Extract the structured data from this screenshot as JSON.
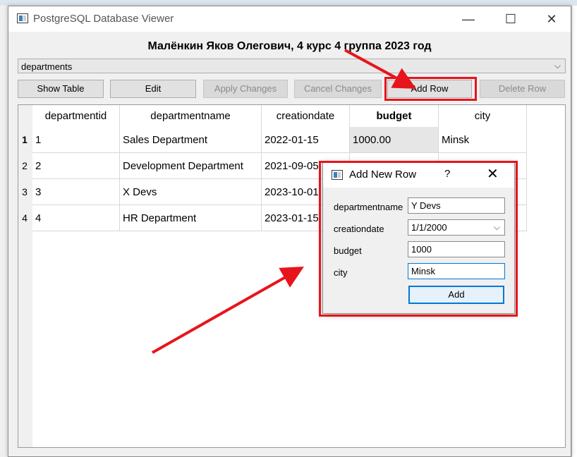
{
  "window": {
    "title": "PostgreSQL Database Viewer",
    "minimize": "—",
    "maximize": "☐",
    "close": "✕"
  },
  "header": {
    "title": "Малёнкин Яков Олегович, 4 курс 4 группа 2023 год"
  },
  "table_select": {
    "value": "departments",
    "arrow": "⌵"
  },
  "toolbar": {
    "show_table": "Show Table",
    "edit": "Edit",
    "apply_changes": "Apply Changes",
    "cancel_changes": "Cancel Changes",
    "add_row": "Add Row",
    "delete_row": "Delete Row"
  },
  "table": {
    "columns": [
      "departmentid",
      "departmentname",
      "creationdate",
      "budget",
      "city"
    ],
    "row_numbers": [
      "1",
      "2",
      "3",
      "4"
    ],
    "rows": [
      [
        "1",
        "Sales Department",
        "2022-01-15",
        "1000.00",
        "Minsk"
      ],
      [
        "2",
        "Development Department",
        "2021-09-05",
        "",
        ""
      ],
      [
        "3",
        "X Devs",
        "2023-10-01",
        "",
        ""
      ],
      [
        "4",
        "HR Department",
        "2023-01-15",
        "",
        ""
      ]
    ]
  },
  "dialog": {
    "title": "Add New Row",
    "help": "?",
    "close": "✕",
    "fields": [
      {
        "label": "departmentname",
        "value": "Y Devs"
      },
      {
        "label": "creationdate",
        "value": "1/1/2000"
      },
      {
        "label": "budget",
        "value": "1000"
      },
      {
        "label": "city",
        "value": "Minsk"
      }
    ],
    "add_button": "Add",
    "chevron": "⌵"
  },
  "colors": {
    "annotation_red": "#e8141b",
    "focus_blue": "#0078d7"
  }
}
